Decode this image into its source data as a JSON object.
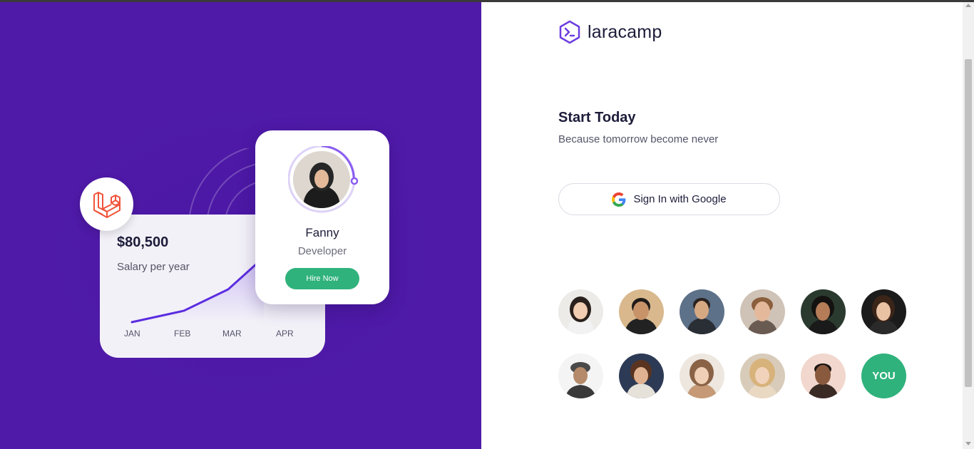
{
  "brand": {
    "name": "laracamp",
    "icon": "terminal-hexagon-icon",
    "color": "#6c3ee0"
  },
  "hero_illustration": {
    "salary_amount": "$80,500",
    "salary_caption": "Salary per year",
    "months": [
      "JAN",
      "FEB",
      "MAR",
      "APR"
    ],
    "badge_icon": "laravel-logo-icon",
    "profile": {
      "name": "Fanny",
      "role": "Developer",
      "cta": "Hire Now"
    }
  },
  "signin": {
    "title": "Start Today",
    "subtitle": "Because tomorrow become never",
    "google_button": "Sign In with Google",
    "google_icon": "google-g-icon"
  },
  "community": {
    "avatars": [
      "member-avatar",
      "member-avatar",
      "member-avatar",
      "member-avatar",
      "member-avatar",
      "member-avatar",
      "member-avatar",
      "member-avatar",
      "member-avatar",
      "member-avatar",
      "member-avatar"
    ],
    "you_label": "YOU"
  },
  "colors": {
    "left_bg": "#4f1aa8",
    "accent_green": "#2fb27c",
    "accent_purple": "#6c3ee0",
    "text_dark": "#1c1c3a"
  }
}
